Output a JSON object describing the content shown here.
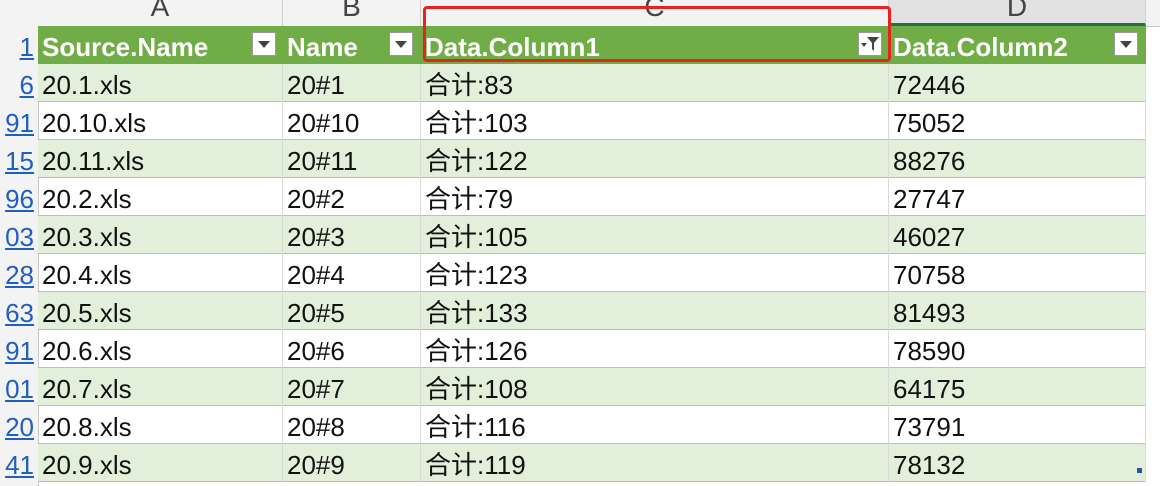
{
  "column_letters": [
    "A",
    "B",
    "C",
    "D"
  ],
  "row_headers": [
    "1",
    "6",
    "91",
    "15",
    "96",
    "03",
    "28",
    "63",
    "91",
    "01",
    "20",
    "41"
  ],
  "table": {
    "headers": [
      "Source.Name",
      "Name",
      "Data.Column1",
      "Data.Column2"
    ],
    "filtered_column": "Data.Column1",
    "rows": [
      [
        "20.1.xls",
        "20#1",
        "合计:83",
        "72446"
      ],
      [
        "20.10.xls",
        "20#10",
        "合计:103",
        "75052"
      ],
      [
        "20.11.xls",
        "20#11",
        "合计:122",
        "88276"
      ],
      [
        "20.2.xls",
        "20#2",
        "合计:79",
        "27747"
      ],
      [
        "20.3.xls",
        "20#3",
        "合计:105",
        "46027"
      ],
      [
        "20.4.xls",
        "20#4",
        "合计:123",
        "70758"
      ],
      [
        "20.5.xls",
        "20#5",
        "合计:133",
        "81493"
      ],
      [
        "20.6.xls",
        "20#6",
        "合计:126",
        "78590"
      ],
      [
        "20.7.xls",
        "20#7",
        "合计:108",
        "64175"
      ],
      [
        "20.8.xls",
        "20#8",
        "合计:116",
        "73791"
      ],
      [
        "20.9.xls",
        "20#9",
        "合计:119",
        "78132"
      ]
    ]
  },
  "colors": {
    "header_green": "#70ad47",
    "band_green": "#e2efda",
    "highlight_red": "#e8231f",
    "row_link_blue": "#1f5fbf"
  },
  "icons": {
    "filter_dropdown": "chevron-down-icon",
    "filter_active": "funnel-filter-icon"
  }
}
